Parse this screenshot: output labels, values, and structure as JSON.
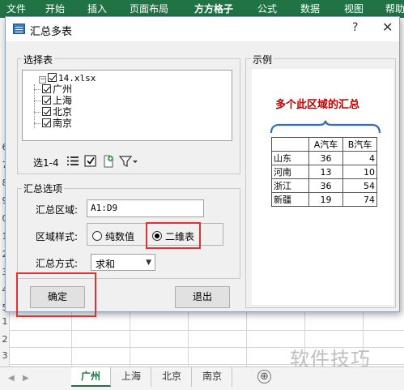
{
  "excel": {
    "ribbon_tabs": [
      "文件",
      "开始",
      "插入",
      "页面布局",
      "方方格子",
      "公式",
      "数据",
      "视图",
      "帮助"
    ],
    "row_numbers_left": [
      "6",
      "7",
      "8",
      "9",
      "0",
      "1",
      "2",
      "3",
      "4",
      "5",
      "6",
      "7",
      "8",
      "9",
      "0"
    ],
    "row_numbers_bottom": [
      "1",
      "2",
      "3"
    ],
    "sheet_tabs": [
      "广州",
      "上海",
      "北京",
      "南京"
    ],
    "active_sheet": "广州",
    "add_sheet_symbol": "⊕"
  },
  "dialog": {
    "title": "汇总多表",
    "help_symbol": "?",
    "close_symbol": "✕",
    "select_group_label": "选择表",
    "tree": {
      "root": "14.xlsx",
      "children": [
        "广州",
        "上海",
        "北京",
        "南京"
      ]
    },
    "toolbar_label": "选1-4",
    "options_group_label": "汇总选项",
    "range_label": "汇总区域:",
    "range_value": "A1:D9",
    "style_label": "区域样式:",
    "style_options": [
      "纯数值",
      "二维表"
    ],
    "style_selected": "二维表",
    "method_label": "汇总方式:",
    "method_value": "求和",
    "ok_button": "确定",
    "exit_button": "退出",
    "example_group_label": "示例",
    "example": {
      "title": "多个此区域的汇总",
      "header": [
        "",
        "A汽车",
        "B汽车"
      ],
      "rows": [
        [
          "山东",
          "36",
          "4"
        ],
        [
          "河南",
          "13",
          "10"
        ],
        [
          "浙江",
          "36",
          "54"
        ],
        [
          "新疆",
          "19",
          "74"
        ]
      ]
    }
  },
  "watermark": "软件技巧"
}
